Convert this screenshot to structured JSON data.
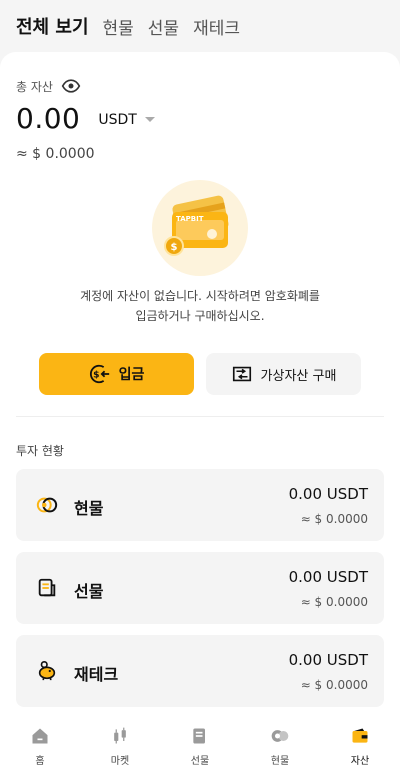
{
  "tabs": [
    "전체 보기",
    "현물",
    "선물",
    "재테크"
  ],
  "total": {
    "label": "총 자산",
    "amount": "0.00",
    "currency": "USDT",
    "approx": "≈ $ 0.0000"
  },
  "illustration": {
    "card_text": "TAPBIT"
  },
  "empty": {
    "line1": "계정에 자산이 없습니다. 시작하려면 암호화폐를",
    "line2": "입금하거나 구매하십시오."
  },
  "buttons": {
    "deposit": "입금",
    "buy": "가상자산 구매"
  },
  "section_title": "투자 현황",
  "accounts": [
    {
      "name": "현물",
      "value": "0.00 USDT",
      "approx": "≈ $ 0.0000",
      "icon": "spot-coins-icon"
    },
    {
      "name": "선물",
      "value": "0.00 USDT",
      "approx": "≈ $ 0.0000",
      "icon": "futures-document-icon"
    },
    {
      "name": "재테크",
      "value": "0.00 USDT",
      "approx": "≈ $ 0.0000",
      "icon": "piggy-bank-icon"
    }
  ],
  "nav": [
    {
      "label": "홈",
      "icon": "home-icon"
    },
    {
      "label": "마켓",
      "icon": "market-candles-icon"
    },
    {
      "label": "선물",
      "icon": "futures-icon"
    },
    {
      "label": "현물",
      "icon": "spot-icon"
    },
    {
      "label": "자산",
      "icon": "wallet-icon"
    }
  ],
  "colors": {
    "accent": "#fbb514",
    "card_bg": "#f4f4f4",
    "page_bg": "#f5f5f5"
  }
}
